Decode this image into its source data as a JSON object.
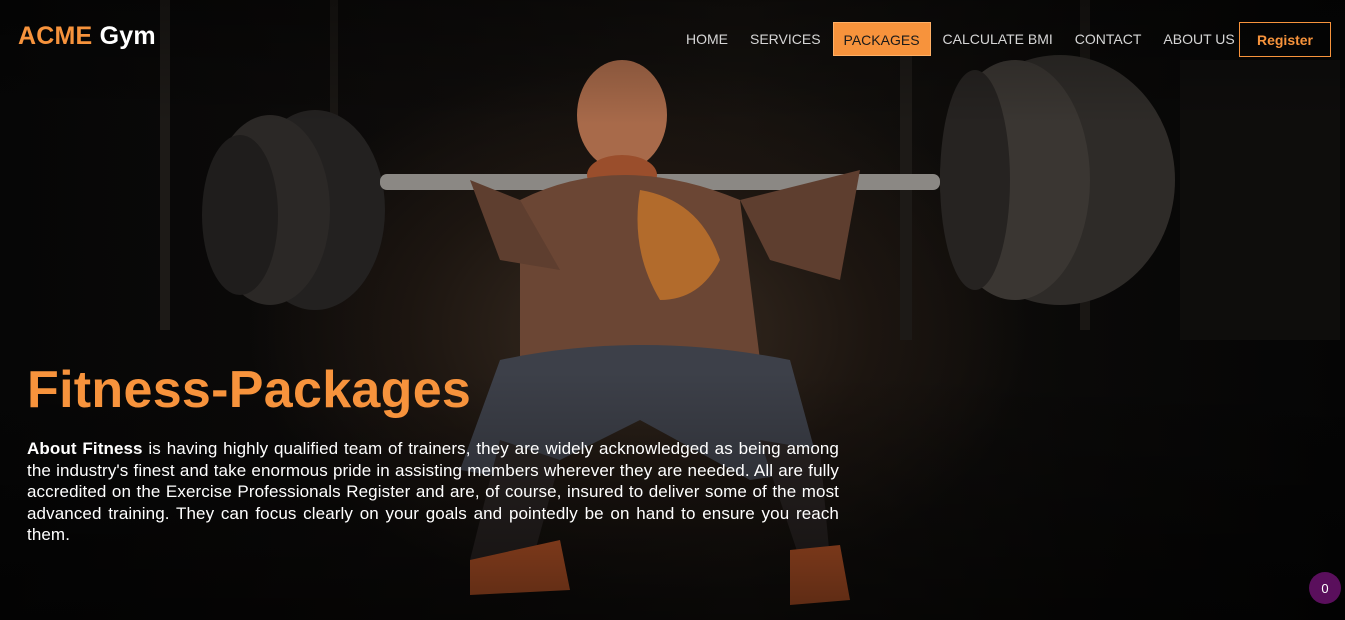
{
  "header": {
    "logo_brand": "ACME",
    "logo_suffix": "Gym",
    "nav": [
      {
        "label": "HOME",
        "active": false
      },
      {
        "label": "SERVICES",
        "active": false
      },
      {
        "label": "PACKAGES",
        "active": true
      },
      {
        "label": "CALCULATE BMI",
        "active": false
      },
      {
        "label": "CONTACT",
        "active": false
      },
      {
        "label": "ABOUT US",
        "active": false
      }
    ],
    "register_label": "Register"
  },
  "hero": {
    "title": "Fitness-Packages",
    "intro_bold": "About Fitness",
    "intro_text": " is having highly qualified team of trainers, they are widely acknowledged as being among the industry's finest and take enormous pride in assisting members wherever they are needed. All are fully accredited on the Exercise Professionals Register and are, of course, insured to deliver some of the most advanced training. They can focus clearly on your goals and pointedly be on hand to ensure you reach them."
  },
  "badge": {
    "count": "0"
  },
  "colors": {
    "accent": "#f7933c",
    "badge": "#5a0f5c",
    "text": "#ffffff",
    "nav_text": "#d6d6d6"
  },
  "icons": {
    "hero_image": "weightlifter-squat-image"
  }
}
